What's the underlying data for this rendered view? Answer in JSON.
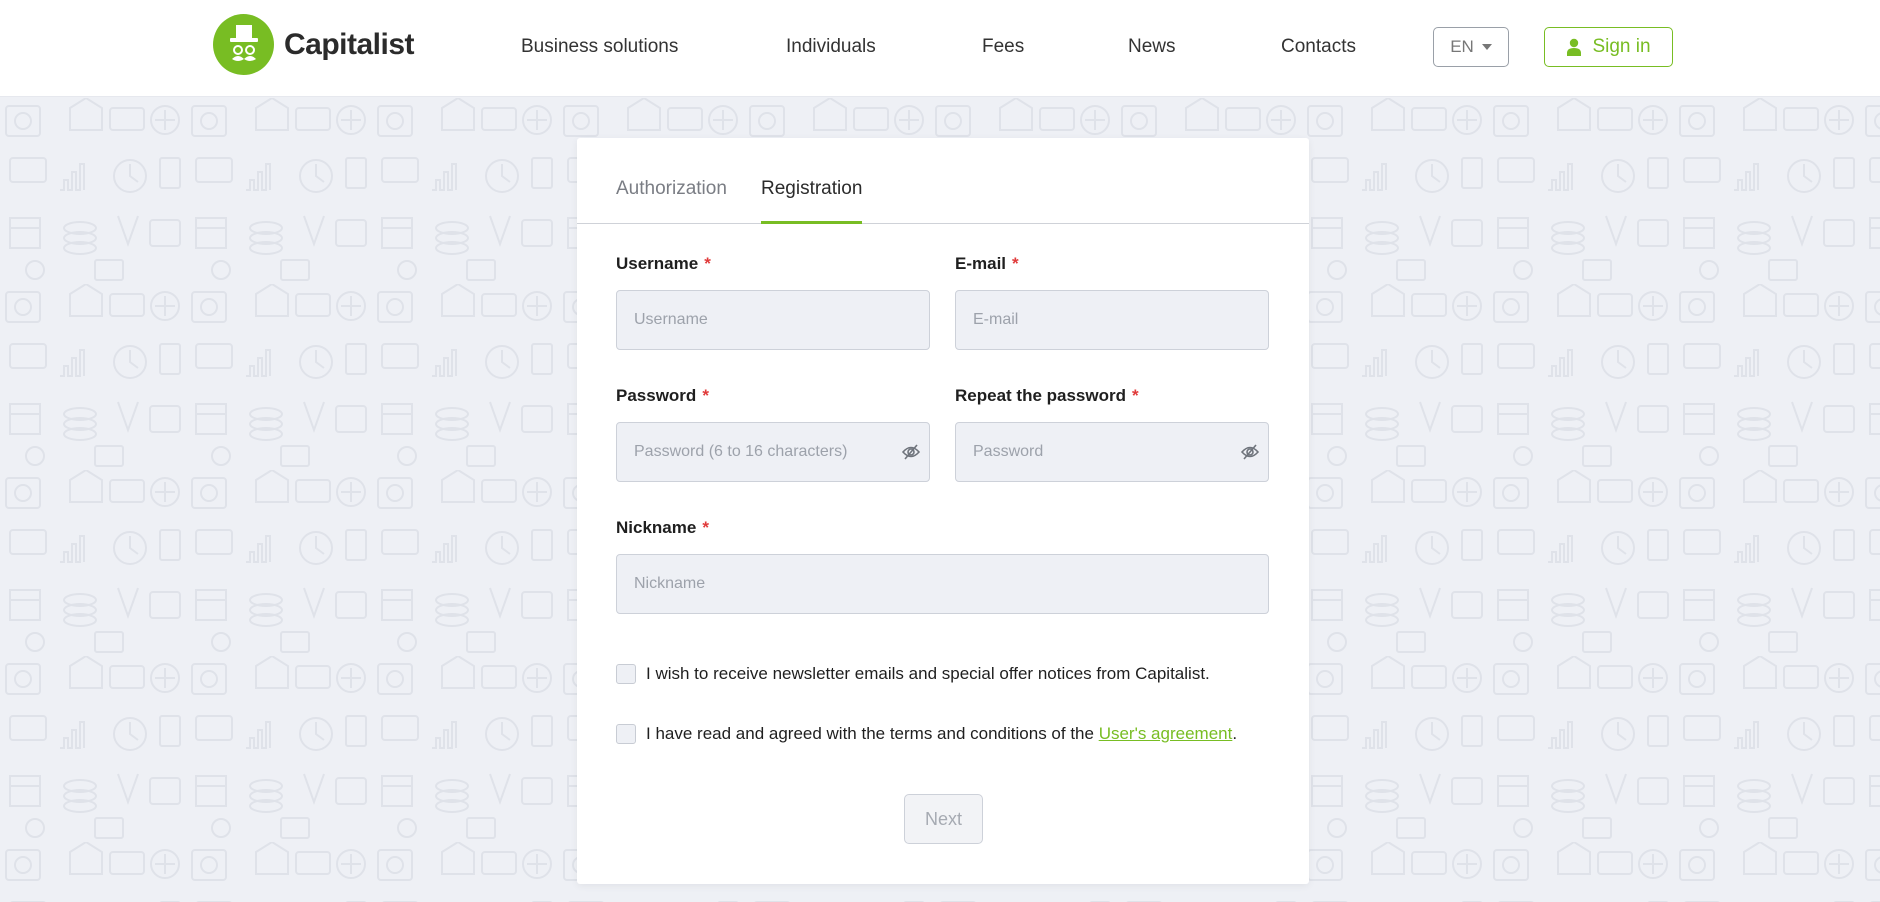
{
  "brand": {
    "name": "Capitalist",
    "accent": "#78bd23"
  },
  "nav": {
    "items": [
      "Business solutions",
      "Individuals",
      "Fees",
      "News",
      "Contacts"
    ],
    "language": "EN",
    "signin_label": "Sign in"
  },
  "tabs": {
    "authorization": "Authorization",
    "registration": "Registration",
    "active": "Registration"
  },
  "form": {
    "username": {
      "label": "Username",
      "required": "*",
      "placeholder": "Username"
    },
    "email": {
      "label": "E-mail",
      "required": "*",
      "placeholder": "E-mail"
    },
    "password": {
      "label": "Password",
      "required": "*",
      "placeholder": "Password (6 to 16 characters)"
    },
    "repeat_password": {
      "label": "Repeat the password",
      "required": "*",
      "placeholder": "Password"
    },
    "nickname": {
      "label": "Nickname",
      "required": "*",
      "placeholder": "Nickname"
    },
    "newsletter_text": "I wish to receive newsletter emails and special offer notices from Capitalist.",
    "terms_prefix": "I have read and agreed with the terms and conditions of the ",
    "terms_link": "User's agreement",
    "terms_suffix": ".",
    "next_label": "Next"
  },
  "icons": {
    "logo": "top-hat-mustache-icon",
    "caret": "caret-down-icon",
    "user": "user-icon",
    "eye": "eye-slash-icon"
  }
}
